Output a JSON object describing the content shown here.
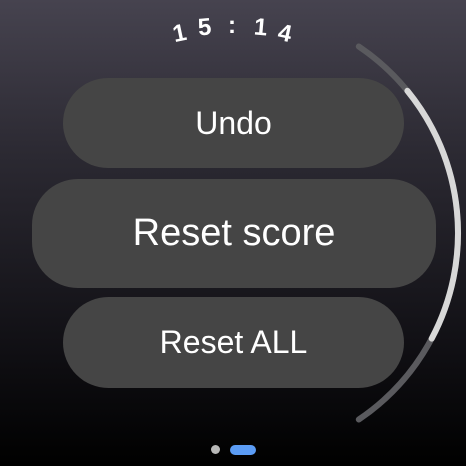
{
  "status_bar": {
    "time_chars": [
      "1",
      "5",
      ":",
      "1",
      "4"
    ]
  },
  "actions": {
    "undo_label": "Undo",
    "reset_score_label": "Reset score",
    "reset_all_label": "Reset ALL"
  },
  "scroll": {
    "thumb_fraction_start": 0.15,
    "thumb_fraction_end": 0.75
  },
  "pagination": {
    "page_count": 2,
    "current_page": 2
  },
  "colors": {
    "button_bg": "#454545",
    "active_dot": "#5b9cf5",
    "inactive_dot": "#b8b8b8",
    "scroll_track": "#5a5a5e",
    "scroll_thumb": "#d8d8d8"
  }
}
